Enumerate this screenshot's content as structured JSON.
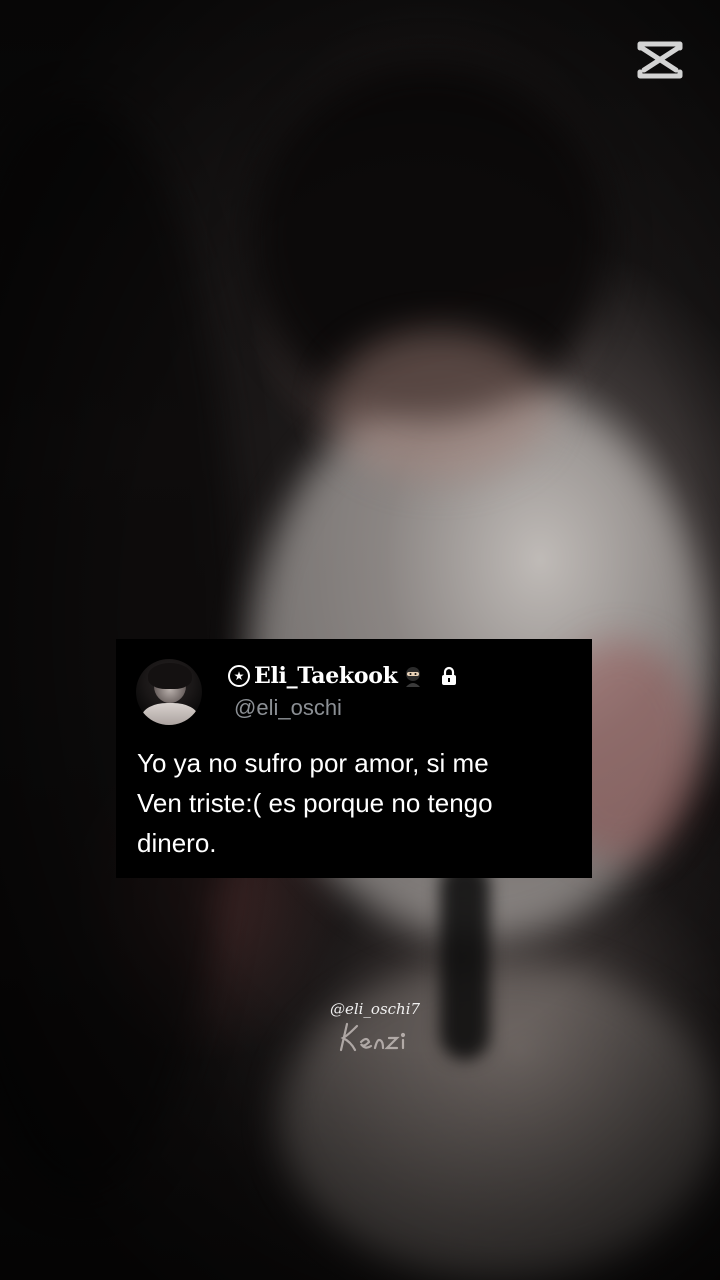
{
  "watermarks": {
    "top_right_logo_icon": "capcut-logo-icon",
    "handle": "@eli_oschi7",
    "signature": "Kenzi"
  },
  "tweet": {
    "display_name": "Eli_Taekook",
    "handle": "@eli_oschi",
    "text": "Yo ya no sufro por amor, si me\nVen triste:( es porque no tengo\ndinero.",
    "badge_icon": "star-badge-icon",
    "emoji_icon": "ninja-icon",
    "protected_icon": "lock-icon",
    "avatar_icon": "profile-avatar"
  },
  "colors": {
    "card_background": "#000000",
    "text": "#ffffff",
    "handle": "#8b8f94"
  }
}
